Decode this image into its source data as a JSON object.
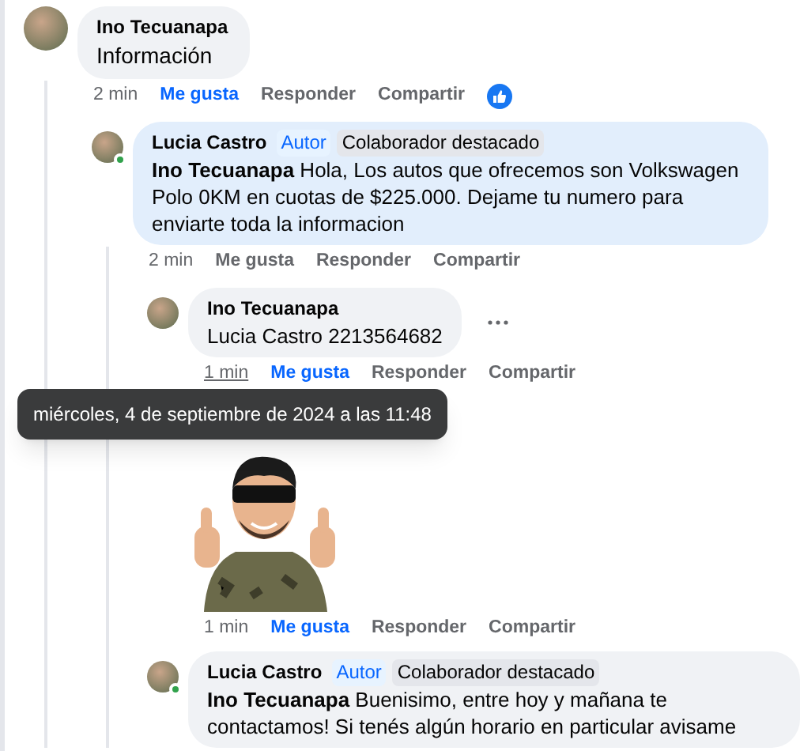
{
  "comments": [
    {
      "author": "Ino Tecuanapa",
      "online": false,
      "text": "Información",
      "time": "2 min",
      "time_hovered": false,
      "like": "Me gusta",
      "liked": true,
      "reply": "Responder",
      "share": "Compartir",
      "reacted": true,
      "more": false,
      "children": [
        {
          "author": "Lucia Castro",
          "online": true,
          "highlight": true,
          "badges": [
            {
              "kind": "author",
              "label": "Autor"
            },
            {
              "kind": "contributor",
              "label": "Colaborador destacado"
            }
          ],
          "text": "**Ino Tecuanapa** Hola, Los autos que ofrecemos son Volkswagen Polo 0KM en cuotas de $225.000. Dejame tu numero para enviarte toda la informacion",
          "time": "2 min",
          "time_hovered": false,
          "like": "Me gusta",
          "liked": false,
          "reply": "Responder",
          "share": "Compartir",
          "reacted": false,
          "more": false,
          "children": [
            {
              "author": "Ino Tecuanapa",
              "online": false,
              "text": "Lucia Castro 2213564682",
              "time": "1 min",
              "time_hovered": true,
              "tooltip": "miércoles, 4 de septiembre de 2024 a las 11:48",
              "like": "Me gusta",
              "liked": true,
              "reply": "Responder",
              "share": "Compartir",
              "reacted": false,
              "more": true
            },
            {
              "kind": "sticker",
              "time": "1 min",
              "time_hovered": false,
              "like": "Me gusta",
              "liked": true,
              "reply": "Responder",
              "share": "Compartir",
              "reacted": false,
              "more": false
            },
            {
              "author": "Lucia Castro",
              "online": true,
              "highlight": false,
              "badges": [
                {
                  "kind": "author",
                  "label": "Autor"
                },
                {
                  "kind": "contributor",
                  "label": "Colaborador destacado"
                }
              ],
              "text": "**Ino Tecuanapa** Buenisimo, entre hoy y mañana te contactamos! Si tenés algún horario en particular avisame"
            }
          ]
        }
      ]
    }
  ]
}
